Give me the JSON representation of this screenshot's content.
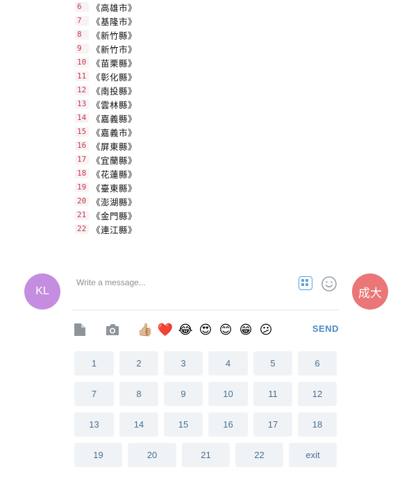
{
  "messages": [
    {
      "num": "6",
      "name": "《高雄市》"
    },
    {
      "num": "7",
      "name": "《基隆市》"
    },
    {
      "num": "8",
      "name": "《新竹縣》"
    },
    {
      "num": "9",
      "name": "《新竹市》"
    },
    {
      "num": "10",
      "name": "《苗栗縣》"
    },
    {
      "num": "11",
      "name": "《彰化縣》"
    },
    {
      "num": "12",
      "name": "《南投縣》"
    },
    {
      "num": "13",
      "name": "《雲林縣》"
    },
    {
      "num": "14",
      "name": "《嘉義縣》"
    },
    {
      "num": "15",
      "name": "《嘉義市》"
    },
    {
      "num": "16",
      "name": "《屏東縣》"
    },
    {
      "num": "17",
      "name": "《宜蘭縣》"
    },
    {
      "num": "18",
      "name": "《花蓮縣》"
    },
    {
      "num": "19",
      "name": "《臺東縣》"
    },
    {
      "num": "20",
      "name": "《澎湖縣》"
    },
    {
      "num": "21",
      "name": "《金門縣》"
    },
    {
      "num": "22",
      "name": "《連江縣》"
    }
  ],
  "avatars": {
    "left": "KL",
    "right": "成大"
  },
  "composer": {
    "placeholder": "Write a message..."
  },
  "toolbar": {
    "emojis": [
      "👍🏼",
      "❤️",
      "😂",
      "😍",
      "😊",
      "😁",
      "😕"
    ],
    "send_label": "SEND"
  },
  "keypad": {
    "row1": [
      "1",
      "2",
      "3",
      "4",
      "5",
      "6"
    ],
    "row2": [
      "7",
      "8",
      "9",
      "10",
      "11",
      "12"
    ],
    "row3": [
      "13",
      "14",
      "15",
      "16",
      "17",
      "18"
    ],
    "row4": [
      "19",
      "20",
      "21",
      "22",
      "exit"
    ]
  },
  "colors": {
    "accent": "#4a8bc4",
    "avatar_left": "#c58de0",
    "avatar_right": "#ea7677",
    "key_bg": "#f0f3f6",
    "number_red": "#d0364d"
  }
}
